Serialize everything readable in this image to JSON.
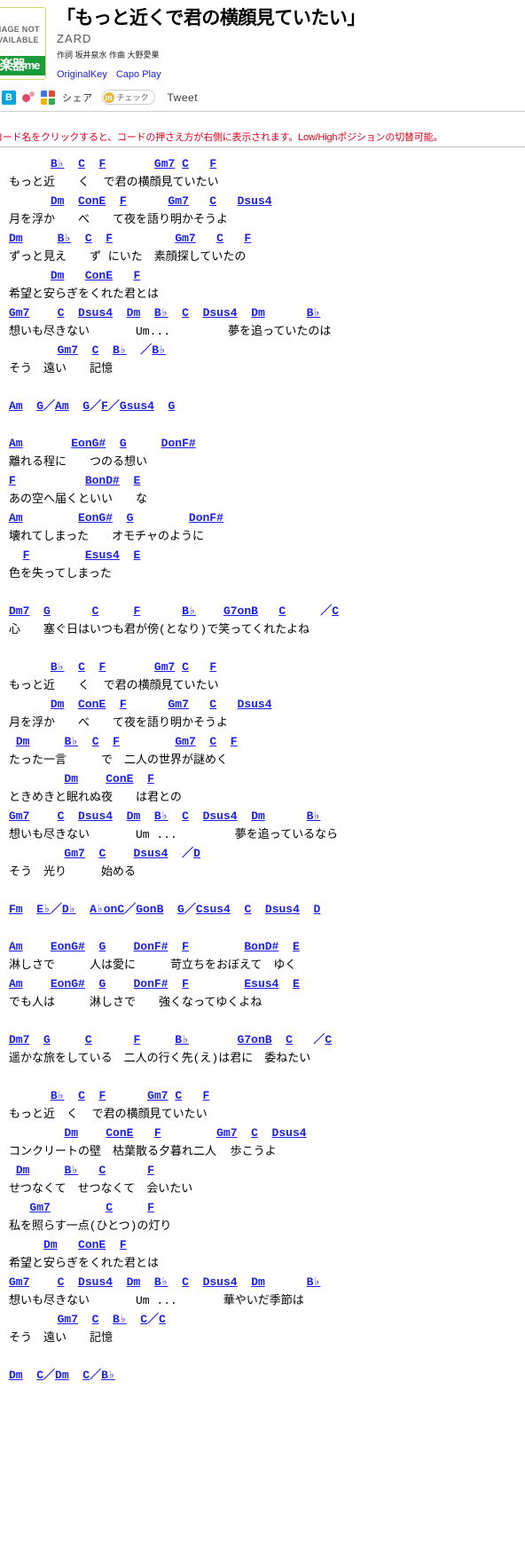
{
  "header": {
    "thumb_alt_line1": "IMAGE NOT",
    "thumb_alt_line2": "AVAILABLE",
    "logo_text": "楽器",
    "logo_suffix": "me",
    "song_title": "「もっと近くで君の横顔見ていたい」",
    "artist": "ZARD",
    "credits": "作詞 坂井泉水  作曲 大野愛果",
    "original_key_label": "OriginalKey",
    "capo_play_label": "Capo Play"
  },
  "share": {
    "hatena_icon": "hatena-bookmark-icon",
    "mixi_icon": "mixi-check-icon",
    "google_icon": "google-plus-icon",
    "share_label": "シェア",
    "check_badge_letter": "m",
    "check_label": "チェック",
    "tweet_label": "Tweet"
  },
  "notice": {
    "text": "コード名をクリックすると、コードの押さえ方が右側に表示されます。Low/Highポジションの切替可能。"
  },
  "colors": {
    "chord_blue": "#1c20e8",
    "notice_red": "#e0001b",
    "logo_green": "#1a9c3c",
    "artist_gray": "#555555"
  },
  "sheet": [
    {
      "type": "chords",
      "text": "      B♭  C  F       Gm7 C   F"
    },
    {
      "type": "lyric",
      "text": "もっと近　　く  で君の横顔見ていたい"
    },
    {
      "type": "chords",
      "text": "      Dm  ConE  F      Gm7   C   Dsus4"
    },
    {
      "type": "lyric",
      "text": "月を浮か　　べ　　て夜を語り明かそうよ"
    },
    {
      "type": "chords",
      "text": "Dm     B♭  C  F         Gm7   C   F"
    },
    {
      "type": "lyric",
      "text": "ずっと見え　　ず にいた　素顔探していたの"
    },
    {
      "type": "chords",
      "text": "      Dm   ConE   F"
    },
    {
      "type": "lyric",
      "text": "希望と安らぎをくれた君とは"
    },
    {
      "type": "chords",
      "text": "Gm7    C  Dsus4  Dm  B♭  C  Dsus4  Dm      B♭"
    },
    {
      "type": "lyric",
      "text": "想いも尽きない　　　　Um...　　　　　夢を追っていたのは"
    },
    {
      "type": "chords",
      "text": "       Gm7  C  B♭  ／B♭"
    },
    {
      "type": "lyric",
      "text": "そう　遠い　　記憶"
    },
    {
      "type": "blank",
      "text": ""
    },
    {
      "type": "chords",
      "text": "Am  G／Am  G／F／Gsus4  G"
    },
    {
      "type": "blank",
      "text": ""
    },
    {
      "type": "chords",
      "text": "Am       EonG#  G     DonF#"
    },
    {
      "type": "lyric",
      "text": "離れる程に　　つのる想い"
    },
    {
      "type": "chords",
      "text": "F          BonD#  E"
    },
    {
      "type": "lyric",
      "text": "あの空へ届くといい　　な"
    },
    {
      "type": "chords",
      "text": "Am        EonG#  G        DonF#"
    },
    {
      "type": "lyric",
      "text": "壊れてしまった　　オモチャのように"
    },
    {
      "type": "chords",
      "text": "  F        Esus4  E"
    },
    {
      "type": "lyric",
      "text": "色を失ってしまった"
    },
    {
      "type": "blank",
      "text": ""
    },
    {
      "type": "chords",
      "text": "Dm7  G      C     F      B♭    G7onB   C     ／C"
    },
    {
      "type": "lyric",
      "text": "心　　塞ぐ日はいつも君が傍(となり)で笑ってくれたよね"
    },
    {
      "type": "blank",
      "text": ""
    },
    {
      "type": "chords",
      "text": "      B♭  C  F       Gm7 C   F"
    },
    {
      "type": "lyric",
      "text": "もっと近　　く  で君の横顔見ていたい"
    },
    {
      "type": "chords",
      "text": "      Dm  ConE  F      Gm7   C   Dsus4"
    },
    {
      "type": "lyric",
      "text": "月を浮か　　べ　　て夜を語り明かそうよ"
    },
    {
      "type": "chords",
      "text": " Dm     B♭  C  F        Gm7  C  F"
    },
    {
      "type": "lyric",
      "text": "たった一言　　　で　二人の世界が謎めく"
    },
    {
      "type": "chords",
      "text": "        Dm    ConE  F"
    },
    {
      "type": "lyric",
      "text": "ときめきと眠れぬ夜　　は君との"
    },
    {
      "type": "chords",
      "text": "Gm7    C  Dsus4  Dm  B♭  C  Dsus4  Dm      B♭"
    },
    {
      "type": "lyric",
      "text": "想いも尽きない　　　　Um ...　　　　　夢を追っているなら"
    },
    {
      "type": "chords",
      "text": "        Gm7  C    Dsus4  ／D"
    },
    {
      "type": "lyric",
      "text": "そう　光り　　　始める"
    },
    {
      "type": "blank",
      "text": ""
    },
    {
      "type": "chords",
      "text": "Fm  E♭／D♭  A♭onC／GonB  G／Csus4  C  Dsus4  D"
    },
    {
      "type": "blank",
      "text": ""
    },
    {
      "type": "chords",
      "text": "Am    EonG#  G    DonF#  F        BonD#  E"
    },
    {
      "type": "lyric",
      "text": "淋しさで　　　人は愛に　　　苛立ちをおぼえて　ゆく"
    },
    {
      "type": "chords",
      "text": "Am    EonG#  G    DonF#  F        Esus4  E"
    },
    {
      "type": "lyric",
      "text": "でも人は　　　淋しさで　　強くなってゆくよね"
    },
    {
      "type": "blank",
      "text": ""
    },
    {
      "type": "chords",
      "text": "Dm7  G     C      F     B♭       G7onB  C   ／C"
    },
    {
      "type": "lyric",
      "text": "遥かな旅をしている　二人の行く先(え)は君に　委ねたい"
    },
    {
      "type": "blank",
      "text": ""
    },
    {
      "type": "chords",
      "text": "      B♭  C  F      Gm7 C   F"
    },
    {
      "type": "lyric",
      "text": "もっと近　く  で君の横顔見ていたい"
    },
    {
      "type": "chords",
      "text": "        Dm    ConE   F        Gm7  C  Dsus4"
    },
    {
      "type": "lyric",
      "text": "コンクリートの壁　枯葉散る夕暮れ二人  歩こうよ"
    },
    {
      "type": "chords",
      "text": " Dm     B♭   C      F"
    },
    {
      "type": "lyric",
      "text": "せつなくて　せつなくて　会いたい"
    },
    {
      "type": "chords",
      "text": "   Gm7        C     F"
    },
    {
      "type": "lyric",
      "text": "私を照らす一点(ひとつ)の灯り"
    },
    {
      "type": "chords",
      "text": "     Dm   ConE  F"
    },
    {
      "type": "lyric",
      "text": "希望と安らぎをくれた君とは"
    },
    {
      "type": "chords",
      "text": "Gm7    C  Dsus4  Dm  B♭  C  Dsus4  Dm      B♭"
    },
    {
      "type": "lyric",
      "text": "想いも尽きない　　　　Um ...　　　　華やいだ季節は"
    },
    {
      "type": "chords",
      "text": "       Gm7  C  B♭  C／C"
    },
    {
      "type": "lyric",
      "text": "そう　遠い　　記憶"
    },
    {
      "type": "blank",
      "text": ""
    },
    {
      "type": "chords",
      "text": "Dm  C／Dm  C／B♭"
    }
  ]
}
